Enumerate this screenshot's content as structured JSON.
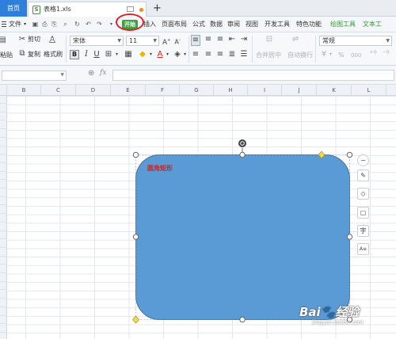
{
  "tabs": {
    "home": "首页",
    "file": "表格1.xls",
    "new": "+"
  },
  "menu": {
    "file": "文件",
    "start": "开始",
    "insert": "插入",
    "page_layout": "页面布局",
    "formula": "公式",
    "data": "数据",
    "review": "审阅",
    "view": "视图",
    "dev_tools": "开发工具",
    "features": "特色功能",
    "drawing_tools": "绘图工具",
    "text_tools": "文本工"
  },
  "ribbon": {
    "cut": "剪切",
    "paste": "粘贴",
    "copy": "复制",
    "format_painter": "格式刷",
    "font_name": "宋体",
    "font_size": "11",
    "bold": "B",
    "italic": "I",
    "underline": "U",
    "merge_center": "合并居中",
    "wrap_text": "自动换行",
    "number_format": "常规",
    "percent": "%",
    "thousands": "000"
  },
  "formula_bar": {
    "fx": "fx"
  },
  "columns": [
    "B",
    "C",
    "D",
    "E",
    "F",
    "G",
    "H",
    "I",
    "J",
    "K",
    "L"
  ],
  "shape": {
    "label": "圆角矩形",
    "fill_color": "#5b9bd5",
    "stroke_color": "#41719c"
  },
  "floating_toolbar": [
    "−",
    "✎",
    "◇",
    "▢",
    "字",
    "A≡"
  ],
  "watermark": {
    "text": "Bai🐾经验",
    "sub": "jingyan.baidu.com"
  },
  "colors": {
    "accent_blue": "#2d7fd9",
    "start_green": "#3fa13f",
    "highlight_red": "#d8232a"
  }
}
